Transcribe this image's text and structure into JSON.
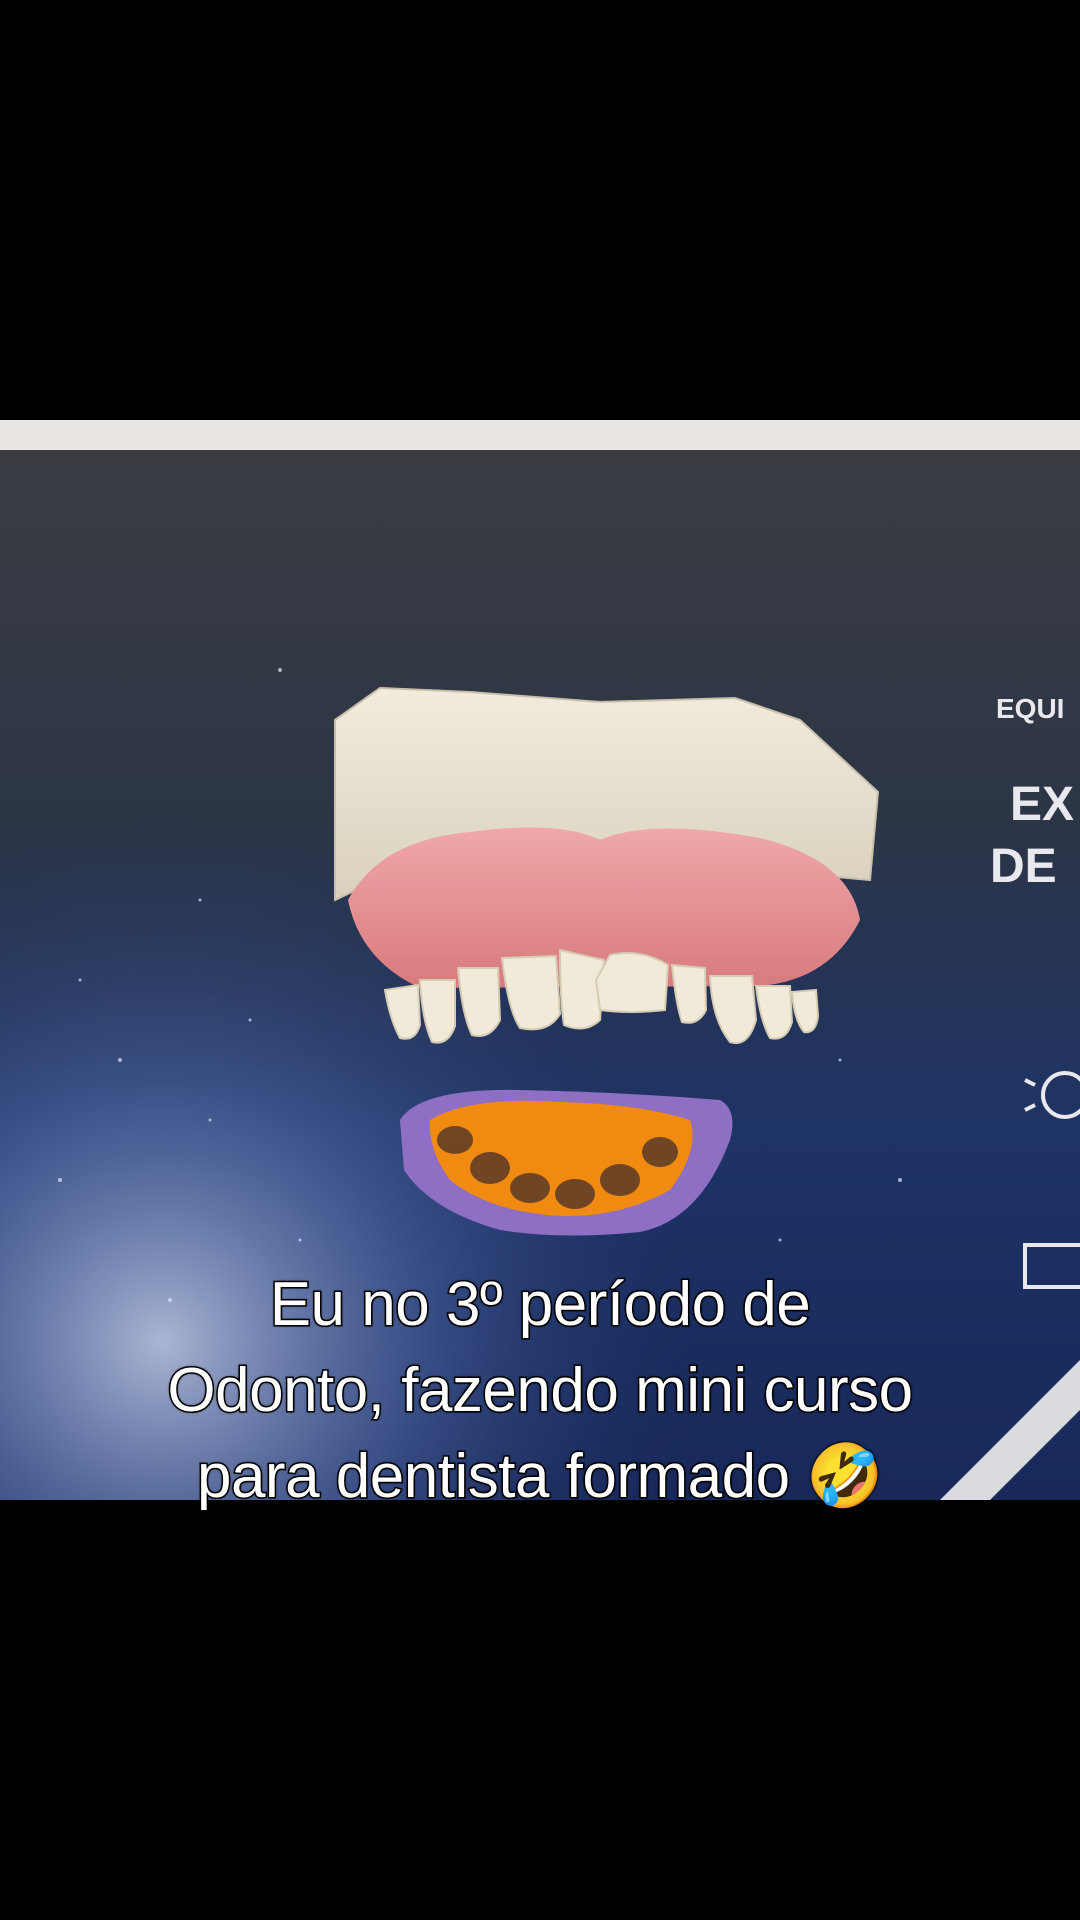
{
  "caption": {
    "line1": "Eu no 3º período de",
    "line2": "Odonto, fazendo mini curso",
    "line3": "para dentista formado 🤣"
  },
  "poster": {
    "small_label": "EQUI",
    "big_line1": "EX",
    "big_line2": "DE"
  },
  "colors": {
    "background": "#000000",
    "caption_text": "#ffffff",
    "gum": "#e48a8c",
    "tooth": "#f1ead8",
    "base": "#e7e0cf",
    "impression_tray": "#8e6fc4",
    "impression_material": "#f08a10"
  }
}
